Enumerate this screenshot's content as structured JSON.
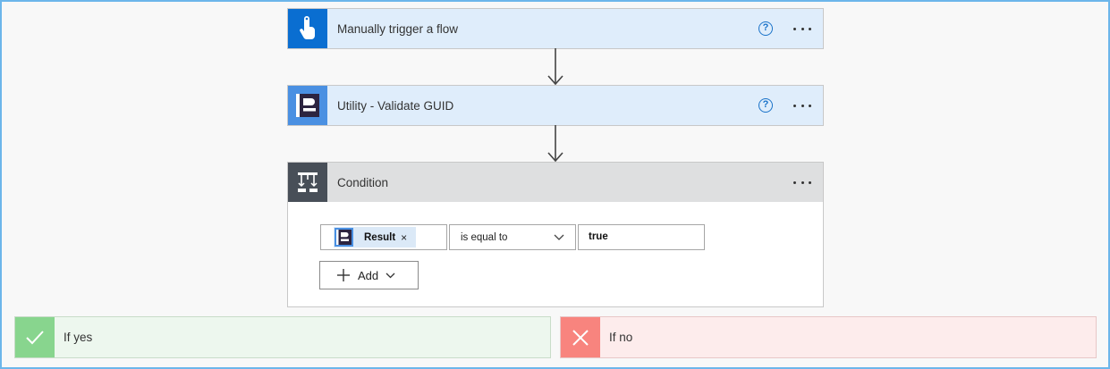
{
  "colors": {
    "trigger_icon_bg": "#0a6ed1",
    "utility_icon_bg": "#4a90e2",
    "condition_icon_bg": "#484f58",
    "yes_icon_bg": "#88d58e",
    "no_icon_bg": "#f8847e",
    "frame_border": "#6cb6ea"
  },
  "flow": {
    "trigger": {
      "title": "Manually trigger a flow",
      "icon": "touch-hand-icon",
      "help_glyph": "?"
    },
    "utility": {
      "title": "Utility - Validate GUID",
      "icon": "utility-logo-icon",
      "help_glyph": "?"
    },
    "condition": {
      "title": "Condition",
      "icon": "condition-icon",
      "token_label": "Result",
      "token_close": "×",
      "operator": "is equal to",
      "value": "true",
      "add_label": "Add"
    }
  },
  "branches": {
    "yes_label": "If yes",
    "no_label": "If no"
  }
}
